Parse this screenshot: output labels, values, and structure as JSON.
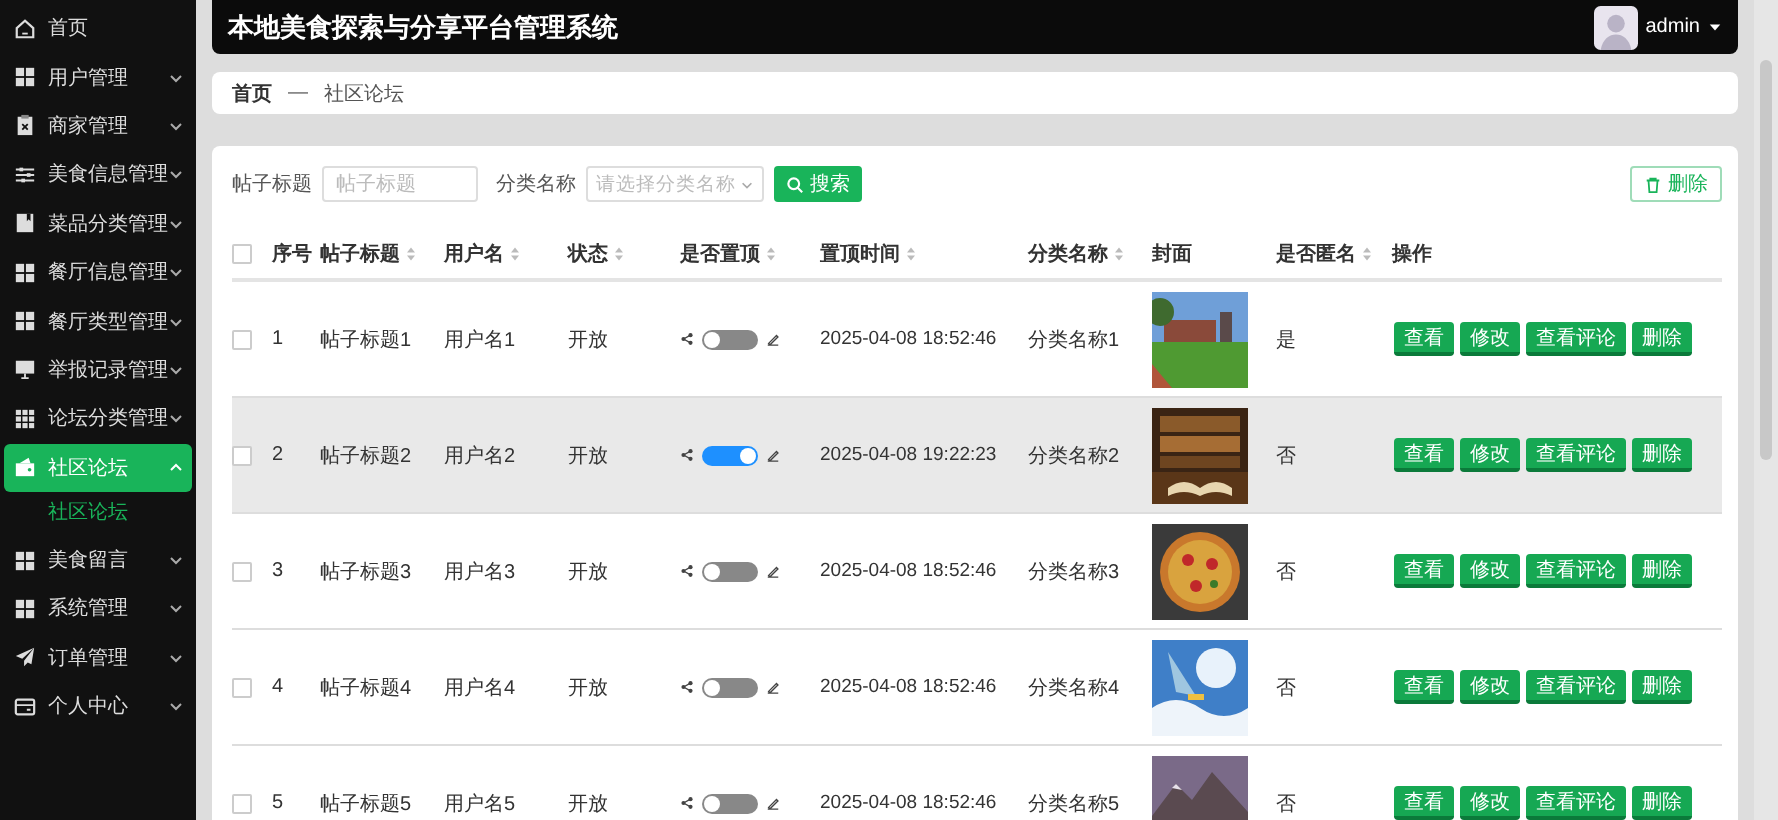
{
  "sidebar": {
    "items": [
      {
        "label": "首页",
        "kind": "link",
        "selected": false
      },
      {
        "label": "用户管理",
        "kind": "menu",
        "selected": false,
        "expanded": false
      },
      {
        "label": "商家管理",
        "kind": "menu",
        "selected": false,
        "expanded": false
      },
      {
        "label": "美食信息管理",
        "kind": "menu",
        "selected": false,
        "expanded": false
      },
      {
        "label": "菜品分类管理",
        "kind": "menu",
        "selected": false,
        "expanded": false
      },
      {
        "label": "餐厅信息管理",
        "kind": "menu",
        "selected": false,
        "expanded": false
      },
      {
        "label": "餐厅类型管理",
        "kind": "menu",
        "selected": false,
        "expanded": false
      },
      {
        "label": "举报记录管理",
        "kind": "menu",
        "selected": false,
        "expanded": false
      },
      {
        "label": "论坛分类管理",
        "kind": "menu",
        "selected": false,
        "expanded": false
      },
      {
        "label": "社区论坛",
        "kind": "menu",
        "selected": true,
        "expanded": true,
        "children": [
          {
            "label": "社区论坛",
            "selected": true
          }
        ]
      },
      {
        "label": "美食留言",
        "kind": "menu",
        "selected": false,
        "expanded": false
      },
      {
        "label": "系统管理",
        "kind": "menu",
        "selected": false,
        "expanded": false
      },
      {
        "label": "订单管理",
        "kind": "menu",
        "selected": false,
        "expanded": false
      },
      {
        "label": "个人中心",
        "kind": "menu",
        "selected": false,
        "expanded": false
      }
    ]
  },
  "header": {
    "title": "本地美食探索与分享平台管理系统",
    "user": "admin"
  },
  "breadcrumb": {
    "items": [
      "首页",
      "社区论坛"
    ],
    "separator": "—"
  },
  "search": {
    "fields": [
      {
        "label": "帖子标题",
        "kind": "input",
        "placeholder": "帖子标题"
      },
      {
        "label": "分类名称",
        "kind": "select",
        "placeholder": "请选择分类名称"
      }
    ],
    "button": "搜索",
    "delete_button": "删除"
  },
  "table": {
    "select_all_checked": false,
    "columns": [
      {
        "label": "序号",
        "sortable": false
      },
      {
        "label": "帖子标题",
        "sortable": true
      },
      {
        "label": "用户名",
        "sortable": true
      },
      {
        "label": "状态",
        "sortable": true
      },
      {
        "label": "是否置顶",
        "sortable": true
      },
      {
        "label": "置顶时间",
        "sortable": true
      },
      {
        "label": "分类名称",
        "sortable": true
      },
      {
        "label": "封面",
        "sortable": false
      },
      {
        "label": "是否匿名",
        "sortable": true
      },
      {
        "label": "操作",
        "sortable": false
      }
    ],
    "rows": [
      {
        "checked": false,
        "hovered": false,
        "index": "1",
        "title": "帖子标题1",
        "user": "用户名1",
        "status": "开放",
        "top": false,
        "time": "2025-04-08 18:52:46",
        "category": "分类名称1",
        "cover": {
          "kind": "picture"
        },
        "anonymous": "是",
        "actions": [
          "查看",
          "修改",
          "查看评论",
          "删除"
        ]
      },
      {
        "checked": false,
        "hovered": true,
        "index": "2",
        "title": "帖子标题2",
        "user": "用户名2",
        "status": "开放",
        "top": true,
        "time": "2025-04-08 19:22:23",
        "category": "分类名称2",
        "cover": {
          "kind": "picture"
        },
        "anonymous": "否",
        "actions": [
          "查看",
          "修改",
          "查看评论",
          "删除"
        ]
      },
      {
        "checked": false,
        "hovered": false,
        "index": "3",
        "title": "帖子标题3",
        "user": "用户名3",
        "status": "开放",
        "top": false,
        "time": "2025-04-08 18:52:46",
        "category": "分类名称3",
        "cover": {
          "kind": "picture"
        },
        "anonymous": "否",
        "actions": [
          "查看",
          "修改",
          "查看评论",
          "删除"
        ]
      },
      {
        "checked": false,
        "hovered": false,
        "index": "4",
        "title": "帖子标题4",
        "user": "用户名4",
        "status": "开放",
        "top": false,
        "time": "2025-04-08 18:52:46",
        "category": "分类名称4",
        "cover": {
          "kind": "picture"
        },
        "anonymous": "否",
        "actions": [
          "查看",
          "修改",
          "查看评论",
          "删除"
        ]
      },
      {
        "checked": false,
        "hovered": false,
        "index": "5",
        "title": "帖子标题5",
        "user": "用户名5",
        "status": "开放",
        "top": false,
        "time": "2025-04-08 18:52:46",
        "category": "分类名称5",
        "cover": {
          "kind": "picture"
        },
        "anonymous": "否",
        "actions": [
          "查看",
          "修改",
          "查看评论",
          "删除"
        ]
      }
    ]
  }
}
